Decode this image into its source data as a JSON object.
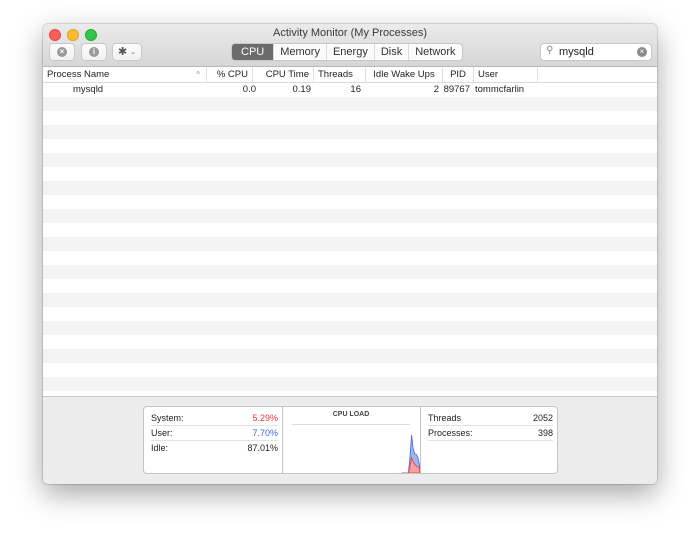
{
  "window": {
    "title": "Activity Monitor (My Processes)"
  },
  "toolbar": {
    "stop_icon": "stop-process-icon",
    "info_icon": "info-icon",
    "gear_icon": "gear-icon",
    "stop_glyph": "×",
    "info_glyph": "i",
    "gear_glyph": "✱",
    "chevron_glyph": "⌄",
    "tabs": [
      {
        "label": "CPU",
        "active": true
      },
      {
        "label": "Memory",
        "active": false
      },
      {
        "label": "Energy",
        "active": false
      },
      {
        "label": "Disk",
        "active": false
      },
      {
        "label": "Network",
        "active": false
      }
    ],
    "search": {
      "value": "mysqld",
      "search_glyph": "⚲",
      "clear_glyph": "×"
    }
  },
  "table": {
    "columns": [
      "Process Name",
      "% CPU",
      "CPU Time",
      "Threads",
      "Idle Wake Ups",
      "PID",
      "User"
    ],
    "sort_indicator": "^",
    "rows": [
      {
        "name": "mysqld",
        "cpu": "0.0",
        "cpu_time": "0.19",
        "threads": "16",
        "idle_wake_ups": "2",
        "pid": "89767",
        "user": "tommcfarlin"
      }
    ]
  },
  "summary": {
    "system_label": "System:",
    "system_value": "5.29%",
    "user_label": "User:",
    "user_value": "7.70%",
    "idle_label": "Idle:",
    "idle_value": "87.01%",
    "cpu_load_title": "CPU LOAD",
    "threads_label": "Threads",
    "threads_value": "2052",
    "processes_label": "Processes:",
    "processes_value": "398",
    "colors": {
      "system": "#f0383d",
      "user": "#3b64e4"
    },
    "cpu_load_history": {
      "system_pct": [
        0,
        0,
        0,
        0,
        0,
        18,
        38,
        28,
        22,
        18,
        15,
        12
      ],
      "user_pct": [
        0,
        0,
        0,
        0,
        0,
        40,
        95,
        60,
        48,
        46,
        38,
        18
      ]
    }
  }
}
